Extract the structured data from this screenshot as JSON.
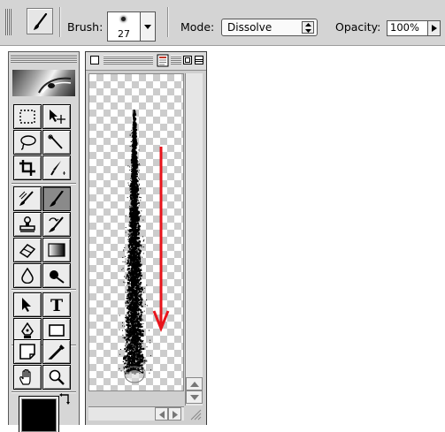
{
  "options_bar": {
    "tool_icon": "paintbrush-icon",
    "brush_label": "Brush:",
    "brush_size": "27",
    "mode_label": "Mode:",
    "mode_value": "Dissolve",
    "opacity_label": "Opacity:",
    "opacity_value": "100%"
  },
  "toolbox": {
    "tools": [
      {
        "name": "marquee-icon"
      },
      {
        "name": "move-icon"
      },
      {
        "name": "lasso-icon"
      },
      {
        "name": "magic-wand-icon"
      },
      {
        "name": "crop-icon"
      },
      {
        "name": "slice-icon"
      },
      {
        "name": "healing-brush-icon"
      },
      {
        "name": "paintbrush-icon",
        "active": true
      },
      {
        "name": "clone-stamp-icon"
      },
      {
        "name": "history-brush-icon"
      },
      {
        "name": "eraser-icon"
      },
      {
        "name": "gradient-icon"
      },
      {
        "name": "blur-icon"
      },
      {
        "name": "dodge-icon"
      },
      {
        "name": "path-select-icon"
      },
      {
        "name": "type-tool-icon",
        "glyph": "T"
      },
      {
        "name": "pen-icon"
      },
      {
        "name": "rectangle-shape-icon"
      },
      {
        "name": "notes-icon"
      },
      {
        "name": "eyedropper-icon"
      },
      {
        "name": "hand-icon"
      },
      {
        "name": "zoom-icon"
      }
    ],
    "foreground_color": "#000000"
  },
  "colors": {
    "annotation_arrow": "#e8141b",
    "stroke": "#000000",
    "panel": "#d6d6d6"
  }
}
